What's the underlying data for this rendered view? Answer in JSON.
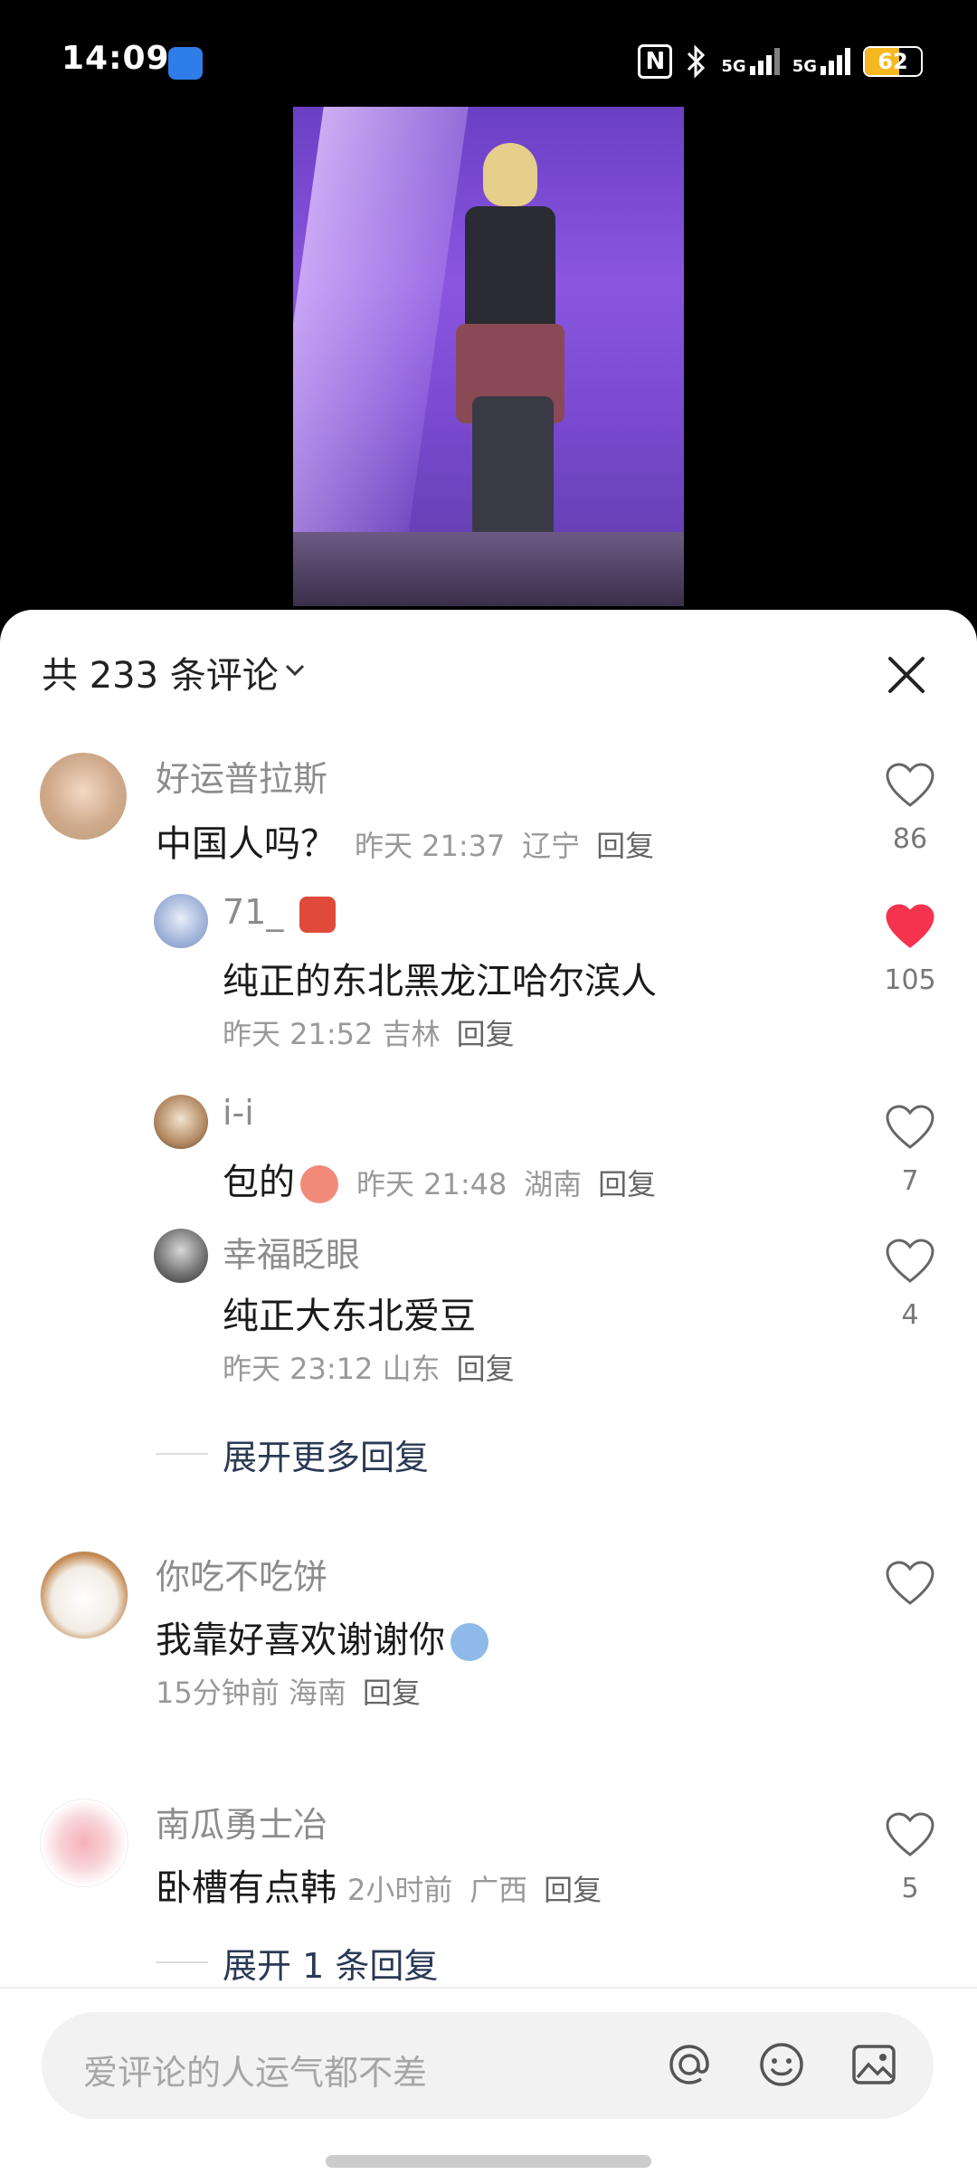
{
  "status_bar": {
    "time": "14:09",
    "network_1": "5G",
    "network_2": "5G",
    "battery_percent": "62",
    "battery_level": 0.62
  },
  "comments_panel": {
    "title": "共 233 条评论",
    "chevron_icon": "chevron-down-icon",
    "close_icon": "close-icon"
  },
  "comments": [
    {
      "user": "好运普拉斯",
      "text": "中国人吗？",
      "time": "昨天 21:37",
      "location": "辽宁",
      "reply_label": "回复",
      "likes": "86",
      "liked": false,
      "replies": [
        {
          "user": "71_",
          "user_emoji": "guitar-emoji",
          "text": "纯正的东北黑龙江哈尔滨人",
          "time": "昨天 21:52",
          "location": "吉林",
          "reply_label": "回复",
          "likes": "105",
          "liked": true
        },
        {
          "user": "i-i",
          "text": "包的",
          "text_emoji": "sticker-emoji",
          "time": "昨天 21:48",
          "location": "湖南",
          "reply_label": "回复",
          "likes": "7",
          "liked": false
        },
        {
          "user": "幸福眨眼",
          "text": "纯正大东北爱豆",
          "time": "昨天 23:12",
          "location": "山东",
          "reply_label": "回复",
          "likes": "4",
          "liked": false
        }
      ],
      "expand_label": "展开更多回复"
    },
    {
      "user": "你吃不吃饼",
      "text": "我靠好喜欢谢谢你",
      "text_emoji": "sticker-emoji",
      "time": "15分钟前",
      "location": "海南",
      "reply_label": "回复",
      "likes": "",
      "liked": false
    },
    {
      "user": "南瓜勇士冶",
      "text": "卧槽有点韩",
      "time": "2小时前",
      "location": "广西",
      "reply_label": "回复",
      "likes": "5",
      "liked": false,
      "expand_label": "展开 1 条回复"
    }
  ],
  "input_bar": {
    "placeholder": "爱评论的人运气都不差",
    "icons": [
      "at-icon",
      "emoji-icon",
      "image-icon"
    ]
  },
  "colors": {
    "liked_heart": "#f5334f",
    "accent_battery": "#f6b820",
    "expand_text": "#2a3a55"
  }
}
